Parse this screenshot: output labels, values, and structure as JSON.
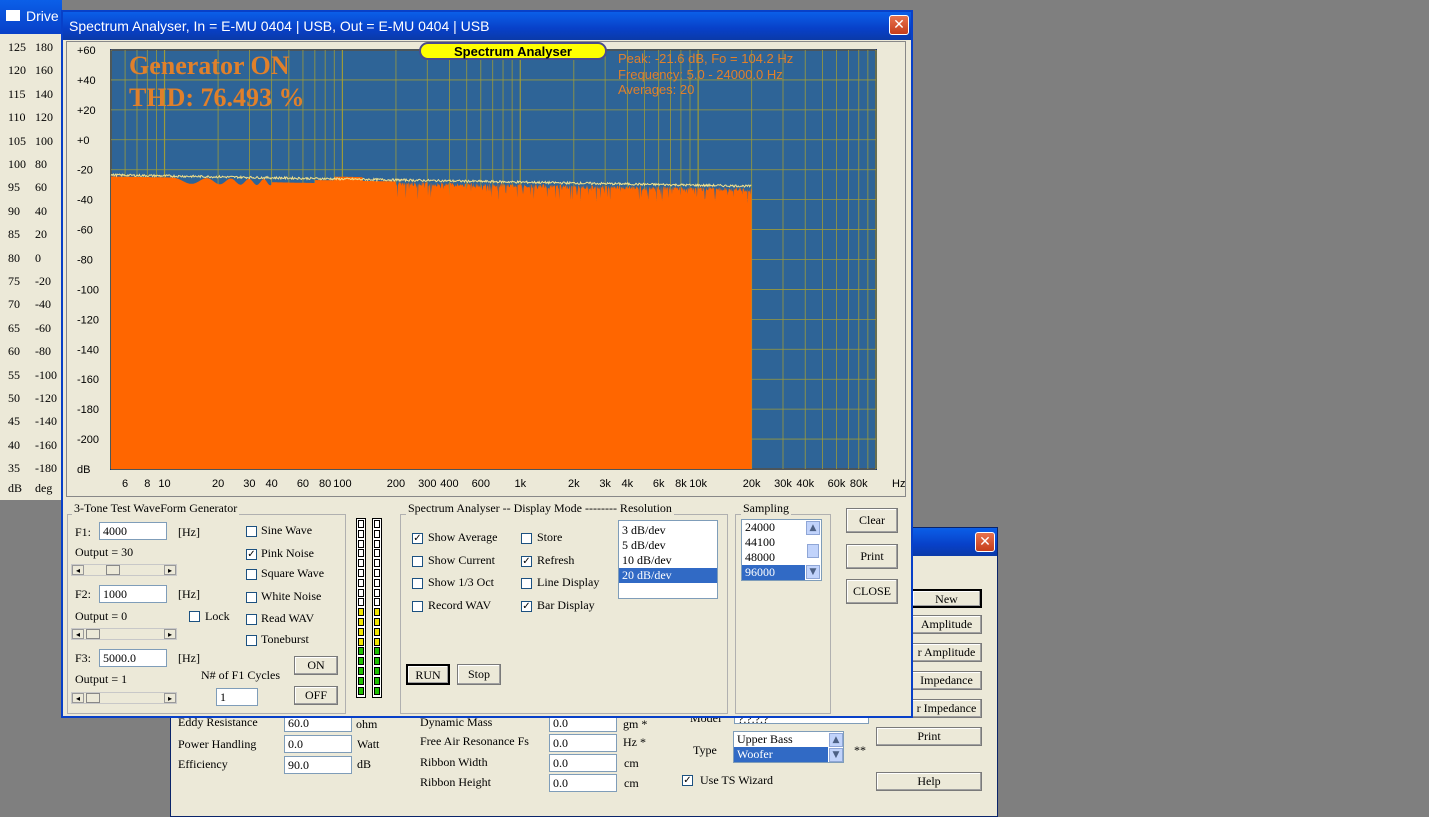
{
  "bg_window": {
    "title": "Drive",
    "scale_rows": [
      [
        "125",
        "180"
      ],
      [
        "120",
        "160"
      ],
      [
        "115",
        "140"
      ],
      [
        "110",
        "120"
      ],
      [
        "105",
        "100"
      ],
      [
        "100",
        "80"
      ],
      [
        "95",
        "60"
      ],
      [
        "90",
        "40"
      ],
      [
        "85",
        "20"
      ],
      [
        "80",
        "0"
      ],
      [
        "75",
        "-20"
      ],
      [
        "70",
        "-40"
      ],
      [
        "65",
        "-60"
      ],
      [
        "60",
        "-80"
      ],
      [
        "55",
        "-100"
      ],
      [
        "50",
        "-120"
      ],
      [
        "45",
        "-140"
      ],
      [
        "40",
        "-160"
      ],
      [
        "35",
        "-180"
      ]
    ],
    "unit_left": "dB",
    "unit_right": "deg"
  },
  "driver_dialog": {
    "close_icon": "close-icon",
    "buttons": {
      "new": "New",
      "amplitude1": "Amplitude",
      "amplitude2": "r Amplitude",
      "impedance1": "Impedance",
      "impedance2": "r Impedance",
      "print": "Print",
      "help": "Help"
    },
    "fields": {
      "eddy_label": "Eddy Resistance",
      "eddy_value": "60.0",
      "eddy_unit": "ohm",
      "power_label": "Power Handling",
      "power_value": "0.0",
      "power_unit": "Watt",
      "eff_label": "Efficiency",
      "eff_value": "90.0",
      "eff_unit": "dB",
      "dyn_label": "Dynamic Mass",
      "dyn_value": "0.0",
      "dyn_unit": "gm *",
      "fs_label": "Free Air Resonance Fs",
      "fs_value": "0.0",
      "fs_unit": "Hz  *",
      "rw_label": "Ribbon Width",
      "rw_value": "0.0",
      "rw_unit": "cm",
      "rh_label": "Ribbon Height",
      "rh_value": "0.0",
      "rh_unit": "cm",
      "model_label": "Model",
      "model_value": "?.?.?.?"
    },
    "type_label": "Type",
    "type_options": [
      "Upper Bass",
      "Woofer"
    ],
    "type_selected": "Woofer",
    "type_note": "**",
    "ts_wizard_label": "Use TS Wizard",
    "ts_wizard_checked": true
  },
  "analyser": {
    "title": "Spectrum Analyser, In = E-MU 0404 | USB, Out = E-MU 0404 | USB",
    "close_icon": "close-icon",
    "plot": {
      "banner": "Spectrum Analyser",
      "generator_text": "Generator ON",
      "thd_text": "THD: 76.493 %",
      "info_peak": "Peak: -21.6 dB, Fo = 104.2 Hz",
      "info_freq": "Frequency: 5.0 - 24000.0 Hz",
      "info_avg": "Averages: 20",
      "y_ticks": [
        "+60",
        "+40",
        "+20",
        "+0",
        "-20",
        "-40",
        "-60",
        "-80",
        "-100",
        "-120",
        "-140",
        "-160",
        "-180",
        "-200"
      ],
      "y_unit": "dB",
      "x_ticks": [
        "6",
        "8",
        "10",
        "20",
        "30",
        "40",
        "60",
        "80",
        "100",
        "200",
        "300",
        "400",
        "600",
        "1k",
        "2k",
        "3k",
        "4k",
        "6k",
        "8k",
        "10k",
        "20k",
        "30k",
        "40k",
        "60k",
        "80k"
      ],
      "x_unit": "Hz",
      "colors": {
        "plot_bg": "#2e6497",
        "fill": "#ff6600",
        "grid": "#9b9a3b",
        "text_orange": "#e0802b",
        "banner_bg": "#ffff00"
      }
    },
    "generator": {
      "group_title": "3-Tone Test WaveForm Generator",
      "f1_label": "F1:",
      "f1_value": "4000",
      "f1_unit": "[Hz]",
      "out1": "Output = 30",
      "f2_label": "F2:",
      "f2_value": "1000",
      "f2_unit": "[Hz]",
      "out2": "Output = 0",
      "f3_label": "F3:",
      "f3_value": "5000.0",
      "f3_unit": "[Hz]",
      "out3": "Output = 1",
      "lock_label": "Lock",
      "cycles_label": "N# of F1 Cycles",
      "cycles_value": "1",
      "on_label": "ON",
      "off_label": "OFF",
      "waves": [
        {
          "label": "Sine Wave",
          "checked": false
        },
        {
          "label": "Pink Noise",
          "checked": true
        },
        {
          "label": "Square Wave",
          "checked": false
        },
        {
          "label": "White Noise",
          "checked": false
        },
        {
          "label": "Read WAV",
          "checked": false
        },
        {
          "label": "Toneburst",
          "checked": false
        }
      ]
    },
    "display": {
      "group_title": "Spectrum Analyser -- Display Mode -------- Resolution",
      "options_left": [
        {
          "label": "Show Average",
          "checked": true
        },
        {
          "label": "Show Current",
          "checked": false
        },
        {
          "label": "Show 1/3 Oct",
          "checked": false
        },
        {
          "label": "Record WAV",
          "checked": false
        }
      ],
      "options_right": [
        {
          "label": "Store",
          "checked": false
        },
        {
          "label": "Refresh",
          "checked": true
        },
        {
          "label": "Line Display",
          "checked": false
        },
        {
          "label": "Bar Display",
          "checked": true
        }
      ],
      "resolution": [
        "3 dB/dev",
        "5 dB/dev",
        "10 dB/dev",
        "20 dB/dev"
      ],
      "resolution_selected": "20 dB/dev",
      "run_label": "RUN",
      "stop_label": "Stop"
    },
    "sampling": {
      "group_title": "Sampling",
      "rates": [
        "24000",
        "44100",
        "48000",
        "96000"
      ],
      "selected": "96000"
    },
    "buttons": {
      "clear": "Clear",
      "print": "Print",
      "close": "CLOSE"
    }
  }
}
